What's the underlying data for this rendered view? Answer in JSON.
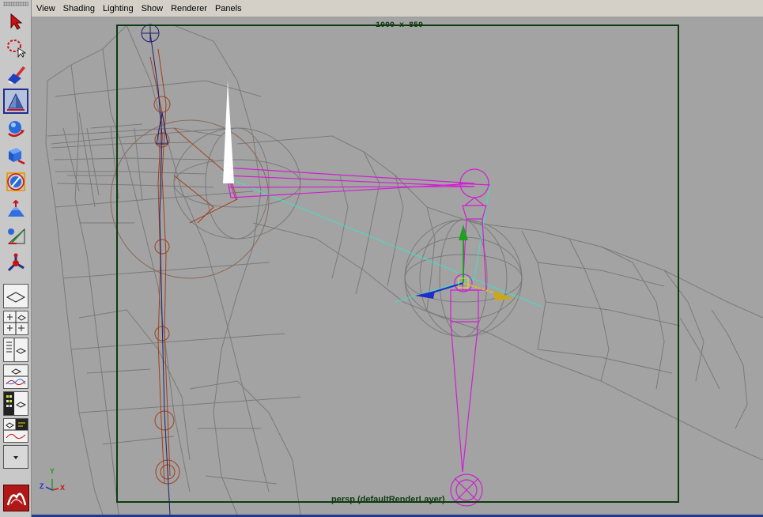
{
  "menubar": {
    "items": [
      "View",
      "Shading",
      "Lighting",
      "Show",
      "Renderer",
      "Panels"
    ]
  },
  "toolbox": {
    "tools": [
      {
        "name": "select-tool-icon",
        "active": false
      },
      {
        "name": "lasso-tool-icon",
        "active": false
      },
      {
        "name": "paint-select-tool-icon",
        "active": false
      },
      {
        "name": "move-tool-icon",
        "active": true
      },
      {
        "name": "rotate-tool-icon",
        "active": false
      },
      {
        "name": "scale-tool-icon",
        "active": false
      },
      {
        "name": "universal-manipulator-icon",
        "active": false
      },
      {
        "name": "soft-modification-icon",
        "active": false
      },
      {
        "name": "show-manipulator-icon",
        "active": false
      },
      {
        "name": "last-tool-icon",
        "active": false
      }
    ],
    "layouts": [
      "single-perspective-view-icon",
      "four-view-layout-icon",
      "outliner-persp-layout-icon",
      "graph-editor-persp-layout-icon",
      "hypershade-persp-layout-icon",
      "persp-graph-layout-icon"
    ]
  },
  "viewport": {
    "resolution_label": "1000 x 850",
    "camera_label": "persp (defaultRenderLayer)",
    "axis_labels": {
      "x": "X",
      "y": "Y",
      "z": "Z"
    },
    "colors": {
      "background": "#a3a3a3",
      "wireframe": "#7a7a7a",
      "resolution_gate": "#0e3a12",
      "selected_joint": "#d21ed2",
      "spine_joints": "#a0401c",
      "pole_line": "#40e0c0"
    }
  }
}
